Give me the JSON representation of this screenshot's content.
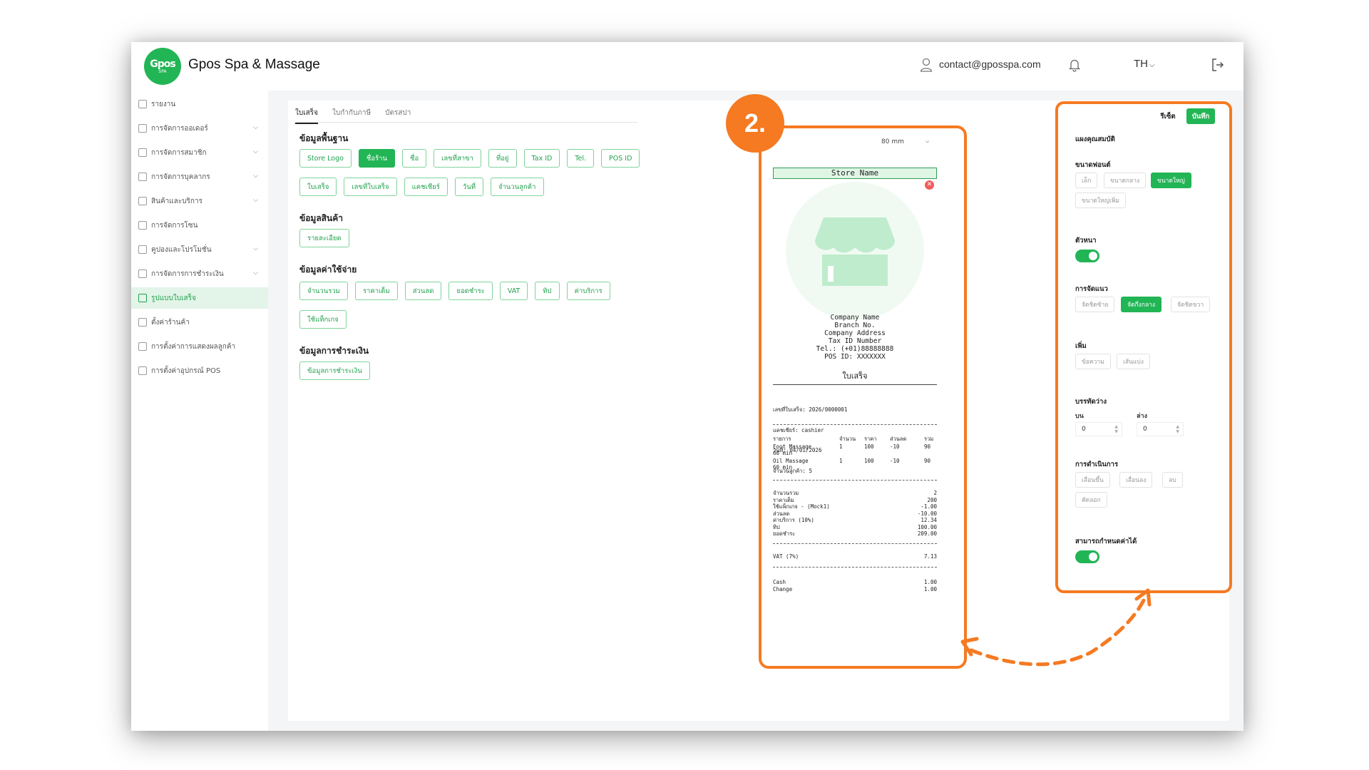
{
  "topbar": {
    "logo_text": "Gpos",
    "logo_sub": "SPA",
    "brand": "Gpos Spa & Massage",
    "email": "contact@gposspa.com",
    "lang": "TH"
  },
  "sidebar": {
    "items": [
      {
        "label": "รายงาน",
        "chevron": false,
        "active": false
      },
      {
        "label": "การจัดการออเดอร์",
        "chevron": true,
        "active": false
      },
      {
        "label": "การจัดการสมาชิก",
        "chevron": true,
        "active": false
      },
      {
        "label": "การจัดการบุคลากร",
        "chevron": true,
        "active": false
      },
      {
        "label": "สินค้าและบริการ",
        "chevron": true,
        "active": false
      },
      {
        "label": "การจัดการโซน",
        "chevron": false,
        "active": false
      },
      {
        "label": "คูปองและโปรโมชั่น",
        "chevron": true,
        "active": false
      },
      {
        "label": "การจัดการการชำระเงิน",
        "chevron": true,
        "active": false
      },
      {
        "label": "รูปแบบใบเสร็จ",
        "chevron": false,
        "active": true
      },
      {
        "label": "ตั้งค่าร้านค้า",
        "chevron": false,
        "active": false
      },
      {
        "label": "การตั้งค่าการแสดงผลลูกค้า",
        "chevron": false,
        "active": false
      },
      {
        "label": "การตั้งค่าอุปกรณ์ POS",
        "chevron": false,
        "active": false
      }
    ]
  },
  "tabs": [
    "ใบเสร็จ",
    "ใบกำกับภาษี",
    "บัตรสปา"
  ],
  "sections": {
    "basic": {
      "title": "ข้อมูลพื้นฐาน",
      "row1": [
        "Store Logo",
        "ชื่อร้าน",
        "ชื่อ",
        "เลขที่สาขา",
        "ที่อยู่",
        "Tax ID",
        "Tel.",
        "POS ID"
      ],
      "row2": [
        "ใบเสร็จ",
        "เลขที่ใบเสร็จ",
        "แคชเชียร์",
        "วันที่",
        "จำนวนลูกค้า"
      ]
    },
    "product": {
      "title": "ข้อมูลสินค้า",
      "chips": [
        "รายละเอียด"
      ]
    },
    "cost": {
      "title": "ข้อมูลค่าใช้จ่าย",
      "row1": [
        "จำนวนรวม",
        "ราคาเต็ม",
        "ส่วนลด",
        "ยอดชำระ",
        "VAT",
        "ทิป",
        "ค่าบริการ"
      ],
      "row2": [
        "ใช้แท็กเกจ"
      ]
    },
    "payment": {
      "title": "ข้อมูลการชำระเงิน",
      "chips": [
        "ข้อมูลการชำระเงิน"
      ]
    }
  },
  "step_badge": "2.",
  "receipt": {
    "paper_size": "80 mm",
    "store_name": "Store Name",
    "header_lines": [
      "Company Name",
      "Branch No.",
      "Company Address",
      "Tax ID Number",
      "Tel.: (+01)88888888",
      "POS ID: XXXXXXX"
    ],
    "title": "ใบเสร็จ",
    "meta_lines": [
      "เลขที่ใบเสร็จ: 2026/0000001",
      "แคชเชียร์: cashier",
      "วันที่: 04/01/2026",
      "จำนวนลูกค้า: 5"
    ],
    "item_headers": [
      "รายการ",
      "จำนวน",
      "ราคา",
      "ส่วนลด",
      "รวม"
    ],
    "items": [
      {
        "name": "Foot Massage",
        "sub": "60 min",
        "qty": "1",
        "price": "100",
        "disc": "-10",
        "total": "90"
      },
      {
        "name": "Oil Massage",
        "sub": "60 min",
        "qty": "1",
        "price": "100",
        "disc": "-10",
        "total": "90"
      }
    ],
    "summary": [
      {
        "label": "จำนวนรวม",
        "value": "2"
      },
      {
        "label": "ราคาเต็ม",
        "value": "200"
      },
      {
        "label": "ใช้แพ็กเกจ - (Mock1)",
        "value": "-1.00"
      },
      {
        "label": "ส่วนลด",
        "value": "-10.00"
      },
      {
        "label": "ค่าบริการ  (10%)",
        "value": "12.34"
      },
      {
        "label": "ทิป",
        "value": "100.00"
      },
      {
        "label": "ยอดชำระ",
        "value": "209.00"
      }
    ],
    "vat": {
      "label": "VAT (7%)",
      "value": "7.13"
    },
    "payment": [
      {
        "label": "Cash",
        "value": "1.00"
      },
      {
        "label": "Change",
        "value": "1.00"
      }
    ]
  },
  "props": {
    "reset_label": "รีเซ็ต",
    "save_label": "บันทึก",
    "panel_title": "แผงคุณสมบัติ",
    "font_size_label": "ขนาดฟอนต์",
    "font_sizes": [
      "เล็ก",
      "ขนาดกลาง",
      "ขนาดใหญ่",
      "ขนาดใหญ่เพิ่ม"
    ],
    "bold_label": "ตัวหนา",
    "align_label": "การจัดแนว",
    "aligns": [
      "จัดชิดซ้าย",
      "จัดกึ่งกลาง",
      "จัดชิดขวา"
    ],
    "add_label": "เพิ่ม",
    "adds": [
      "ข้อความ",
      "เส้นแบ่ง"
    ],
    "spacing_label": "บรรทัดว่าง",
    "top_label": "บน",
    "bottom_label": "ล่าง",
    "top_value": "0",
    "bottom_value": "0",
    "actions_label": "การดำเนินการ",
    "actions": [
      "เลื่อนขึ้น",
      "เลื่อนลง",
      "ลบ",
      "คัดลอก"
    ],
    "editable_label": "สามารถกำหนดค่าได้"
  },
  "colors": {
    "accent": "#22b555",
    "highlight": "#f57a22",
    "active_bg": "#e3f4e8"
  }
}
